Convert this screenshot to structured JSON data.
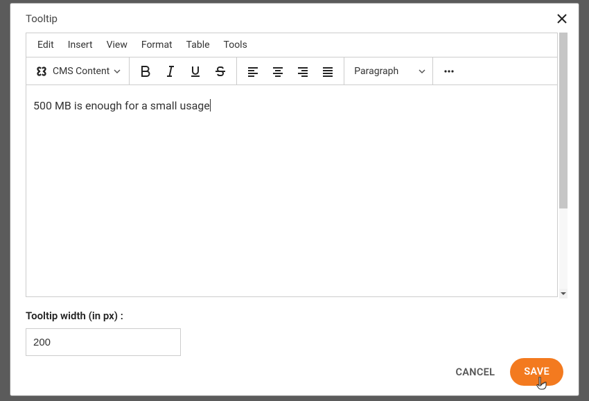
{
  "modal": {
    "title": "Tooltip"
  },
  "menubar": {
    "edit": "Edit",
    "insert": "Insert",
    "view": "View",
    "format": "Format",
    "table": "Table",
    "tools": "Tools"
  },
  "toolbar": {
    "cms_label": "CMS Content",
    "block_format": "Paragraph"
  },
  "editor": {
    "content": "500 MB is enough for a small usage"
  },
  "tooltip_width": {
    "label": "Tooltip width (in px) :",
    "value": "200"
  },
  "footer": {
    "cancel": "CANCEL",
    "save": "SAVE"
  }
}
